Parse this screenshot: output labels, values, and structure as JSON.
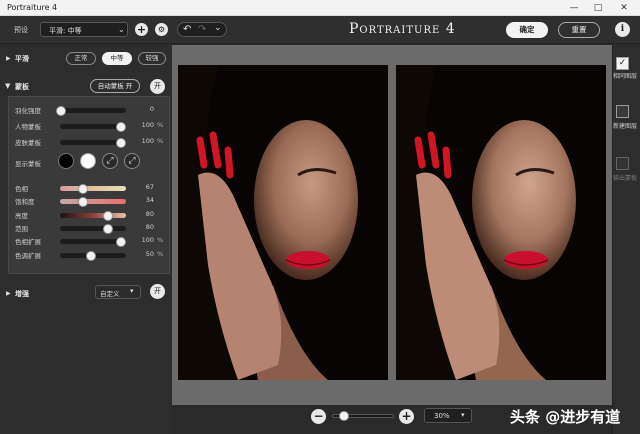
{
  "window": {
    "title": "Portraiture 4",
    "minimize": "—",
    "maximize": "□",
    "close": "✕"
  },
  "toolbar": {
    "preset_label": "预设",
    "preset_value": "平滑: 中等",
    "add_symbol": "+",
    "gear_symbol": "⚙",
    "undo_symbol": "↶",
    "redo_symbol": "↷",
    "history_symbol": "⌄",
    "app_title": "Portraiture 4",
    "ok_label": "确定",
    "reset_label": "重置",
    "info_symbol": "i"
  },
  "smoothing": {
    "title": "平滑",
    "options": [
      "正常",
      "中等",
      "较强"
    ],
    "selected": "中等"
  },
  "mask": {
    "title": "蒙板",
    "auto_button": "自动蒙板 开",
    "toggle": "开",
    "sliders_top": [
      {
        "label": "羽化强度",
        "value": "0",
        "unit": "",
        "fraction": 0.0
      },
      {
        "label": "人物蒙板",
        "value": "100",
        "unit": "%",
        "fraction": 1.0
      },
      {
        "label": "皮肤蒙板",
        "value": "100",
        "unit": "%",
        "fraction": 1.0
      }
    ],
    "show_label": "显示蒙板",
    "sliders_bottom": [
      {
        "label": "色相",
        "value": "67",
        "unit": "",
        "fraction": 0.36
      },
      {
        "label": "饱和度",
        "value": "34",
        "unit": "",
        "fraction": 0.36
      },
      {
        "label": "亮度",
        "value": "80",
        "unit": "",
        "fraction": 0.78
      },
      {
        "label": "范围",
        "value": "80",
        "unit": "",
        "fraction": 0.78
      },
      {
        "label": "色相扩展",
        "value": "100",
        "unit": "%",
        "fraction": 1.0
      },
      {
        "label": "色调扩展",
        "value": "50",
        "unit": "%",
        "fraction": 0.5
      }
    ]
  },
  "enhance": {
    "title": "增强",
    "custom_label": "自定义",
    "dropdown_symbol": "▾",
    "toggle": "开"
  },
  "right_panel": {
    "items": [
      {
        "label": "相同图层",
        "checked": true
      },
      {
        "label": "新建图层",
        "checked": false
      },
      {
        "label": "输出蒙板",
        "checked": false
      }
    ]
  },
  "zoom": {
    "minus": "−",
    "plus": "+",
    "value": "30%",
    "slider_fraction": 0.12
  },
  "watermark": "头条 @进步有道",
  "colors": {
    "accent": "#f2f2f2",
    "background": "#2d2d2d",
    "canvas": "#6b6b6b"
  }
}
